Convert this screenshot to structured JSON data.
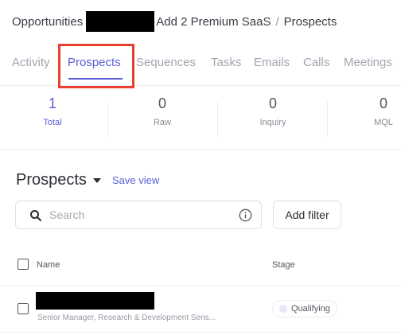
{
  "breadcrumb": {
    "root": "Opportunities",
    "deal": "Add 2 Premium SaaS",
    "separator": "/",
    "current": "Prospects"
  },
  "tabs": [
    {
      "label": "Activity",
      "active": false
    },
    {
      "label": "Prospects",
      "active": true
    },
    {
      "label": "Sequences",
      "active": false
    },
    {
      "label": "Tasks",
      "active": false
    },
    {
      "label": "Emails",
      "active": false
    },
    {
      "label": "Calls",
      "active": false
    },
    {
      "label": "Meetings",
      "active": false
    }
  ],
  "stats": [
    {
      "value": "1",
      "label": "Total",
      "active": true
    },
    {
      "value": "0",
      "label": "Raw",
      "active": false
    },
    {
      "value": "0",
      "label": "Inquiry",
      "active": false
    },
    {
      "value": "0",
      "label": "MQL",
      "active": false
    }
  ],
  "list": {
    "title": "Prospects",
    "save_view": "Save view"
  },
  "search": {
    "placeholder": "Search",
    "value": ""
  },
  "add_filter": "Add filter",
  "table": {
    "columns": [
      "Name",
      "Stage"
    ],
    "rows": [
      {
        "title": "Senior Manager, Research & Development Sens...",
        "stage": "Qualifying"
      }
    ]
  },
  "colors": {
    "accent": "#5b5fd6",
    "highlight": "#e8402f",
    "stage_dot": "#e6e6fa"
  },
  "icons": {
    "search": "search-icon",
    "info": "info-icon",
    "caret": "chevron-down-icon"
  }
}
